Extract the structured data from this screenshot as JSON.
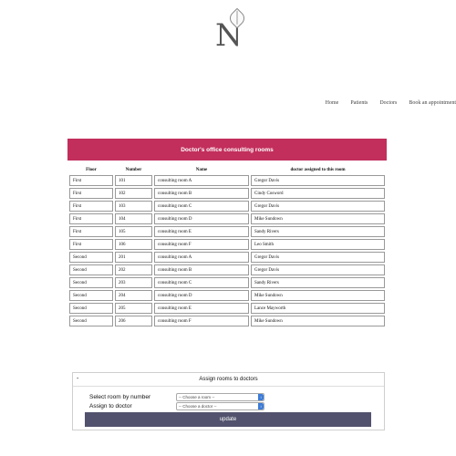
{
  "logo": {
    "letter": "N"
  },
  "nav": {
    "items": [
      "Home",
      "Patients",
      "Doctors",
      "Book an appointment"
    ]
  },
  "banner": {
    "title": "Doctor's office consulting rooms"
  },
  "table": {
    "headers": [
      "Floor",
      "Number",
      "Name",
      "doctor assigned to this room"
    ],
    "rows": [
      [
        "First",
        "101",
        "consulting room A",
        "Gregor Davis"
      ],
      [
        "First",
        "102",
        "consulting room B",
        "Cindy Cosword"
      ],
      [
        "First",
        "103",
        "consulting room C",
        "Gregor Davis"
      ],
      [
        "First",
        "104",
        "consulting room D",
        "Mike Sundown"
      ],
      [
        "First",
        "105",
        "consulting room E",
        "Sandy Rivers"
      ],
      [
        "First",
        "106",
        "consulting room F",
        "Leo Smith"
      ],
      [
        "Second",
        "201",
        "consulting room A",
        "Gregor Davis"
      ],
      [
        "Second",
        "202",
        "consulting room B",
        "Gregor Davis"
      ],
      [
        "Second",
        "203",
        "consulting room C",
        "Sandy Rivers"
      ],
      [
        "Second",
        "204",
        "consulting room D",
        "Mike Sundown"
      ],
      [
        "Second",
        "205",
        "consulting room E",
        "Lance Mayworth"
      ],
      [
        "Second",
        "206",
        "consulting room F",
        "Mike Sundown"
      ]
    ]
  },
  "assign_panel": {
    "collapse_symbol": "-",
    "title": "Assign rooms to doctors",
    "room_label": "Select room by number",
    "room_placeholder": "-- Choose a room --",
    "doctor_label": "Assign to doctor",
    "doctor_placeholder": "-- Choose a doctor --",
    "update_label": "update"
  }
}
